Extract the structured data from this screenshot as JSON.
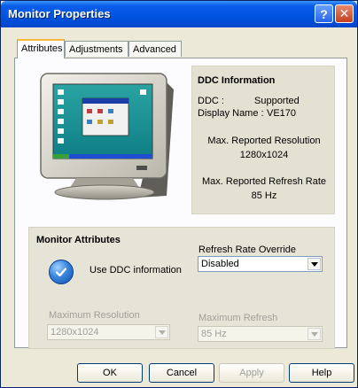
{
  "window": {
    "title": "Monitor Properties"
  },
  "titlebar": {
    "help_glyph": "?",
    "close_glyph": "✕"
  },
  "tabs": [
    {
      "label": "Attributes",
      "active": true
    },
    {
      "label": "Adjustments",
      "active": false
    },
    {
      "label": "Advanced",
      "active": false
    }
  ],
  "ddc_info": {
    "title": "DDC Information",
    "ddc_label": "DDC :",
    "ddc_value": "Supported",
    "display_name_label": "Display Name :",
    "display_name_value": "VE170",
    "max_res_label": "Max. Reported Resolution",
    "max_res_value": "1280x1024",
    "max_refresh_label": "Max. Reported Refresh Rate",
    "max_refresh_value": "85 Hz"
  },
  "monitor_attributes": {
    "title": "Monitor Attributes",
    "use_ddc_label": "Use DDC information",
    "use_ddc_checked": true,
    "refresh_override_label": "Refresh Rate Override",
    "refresh_override_value": "Disabled",
    "max_resolution_label": "Maximum Resolution",
    "max_resolution_value": "1280x1024",
    "max_refresh_label": "Maximum Refresh",
    "max_refresh_value": "85 Hz"
  },
  "buttons": {
    "ok": "OK",
    "cancel": "Cancel",
    "apply": "Apply",
    "help": "Help"
  },
  "icons": {
    "monitor": "monitor-icon",
    "check": "check-icon",
    "dropdown": "chevron-down-icon"
  },
  "colors": {
    "titlebar": "#0054e3",
    "window_bg": "#ece9d8",
    "ddc_box_bg": "#e3e1d2",
    "active_tab_accent": "#f9b73d"
  }
}
